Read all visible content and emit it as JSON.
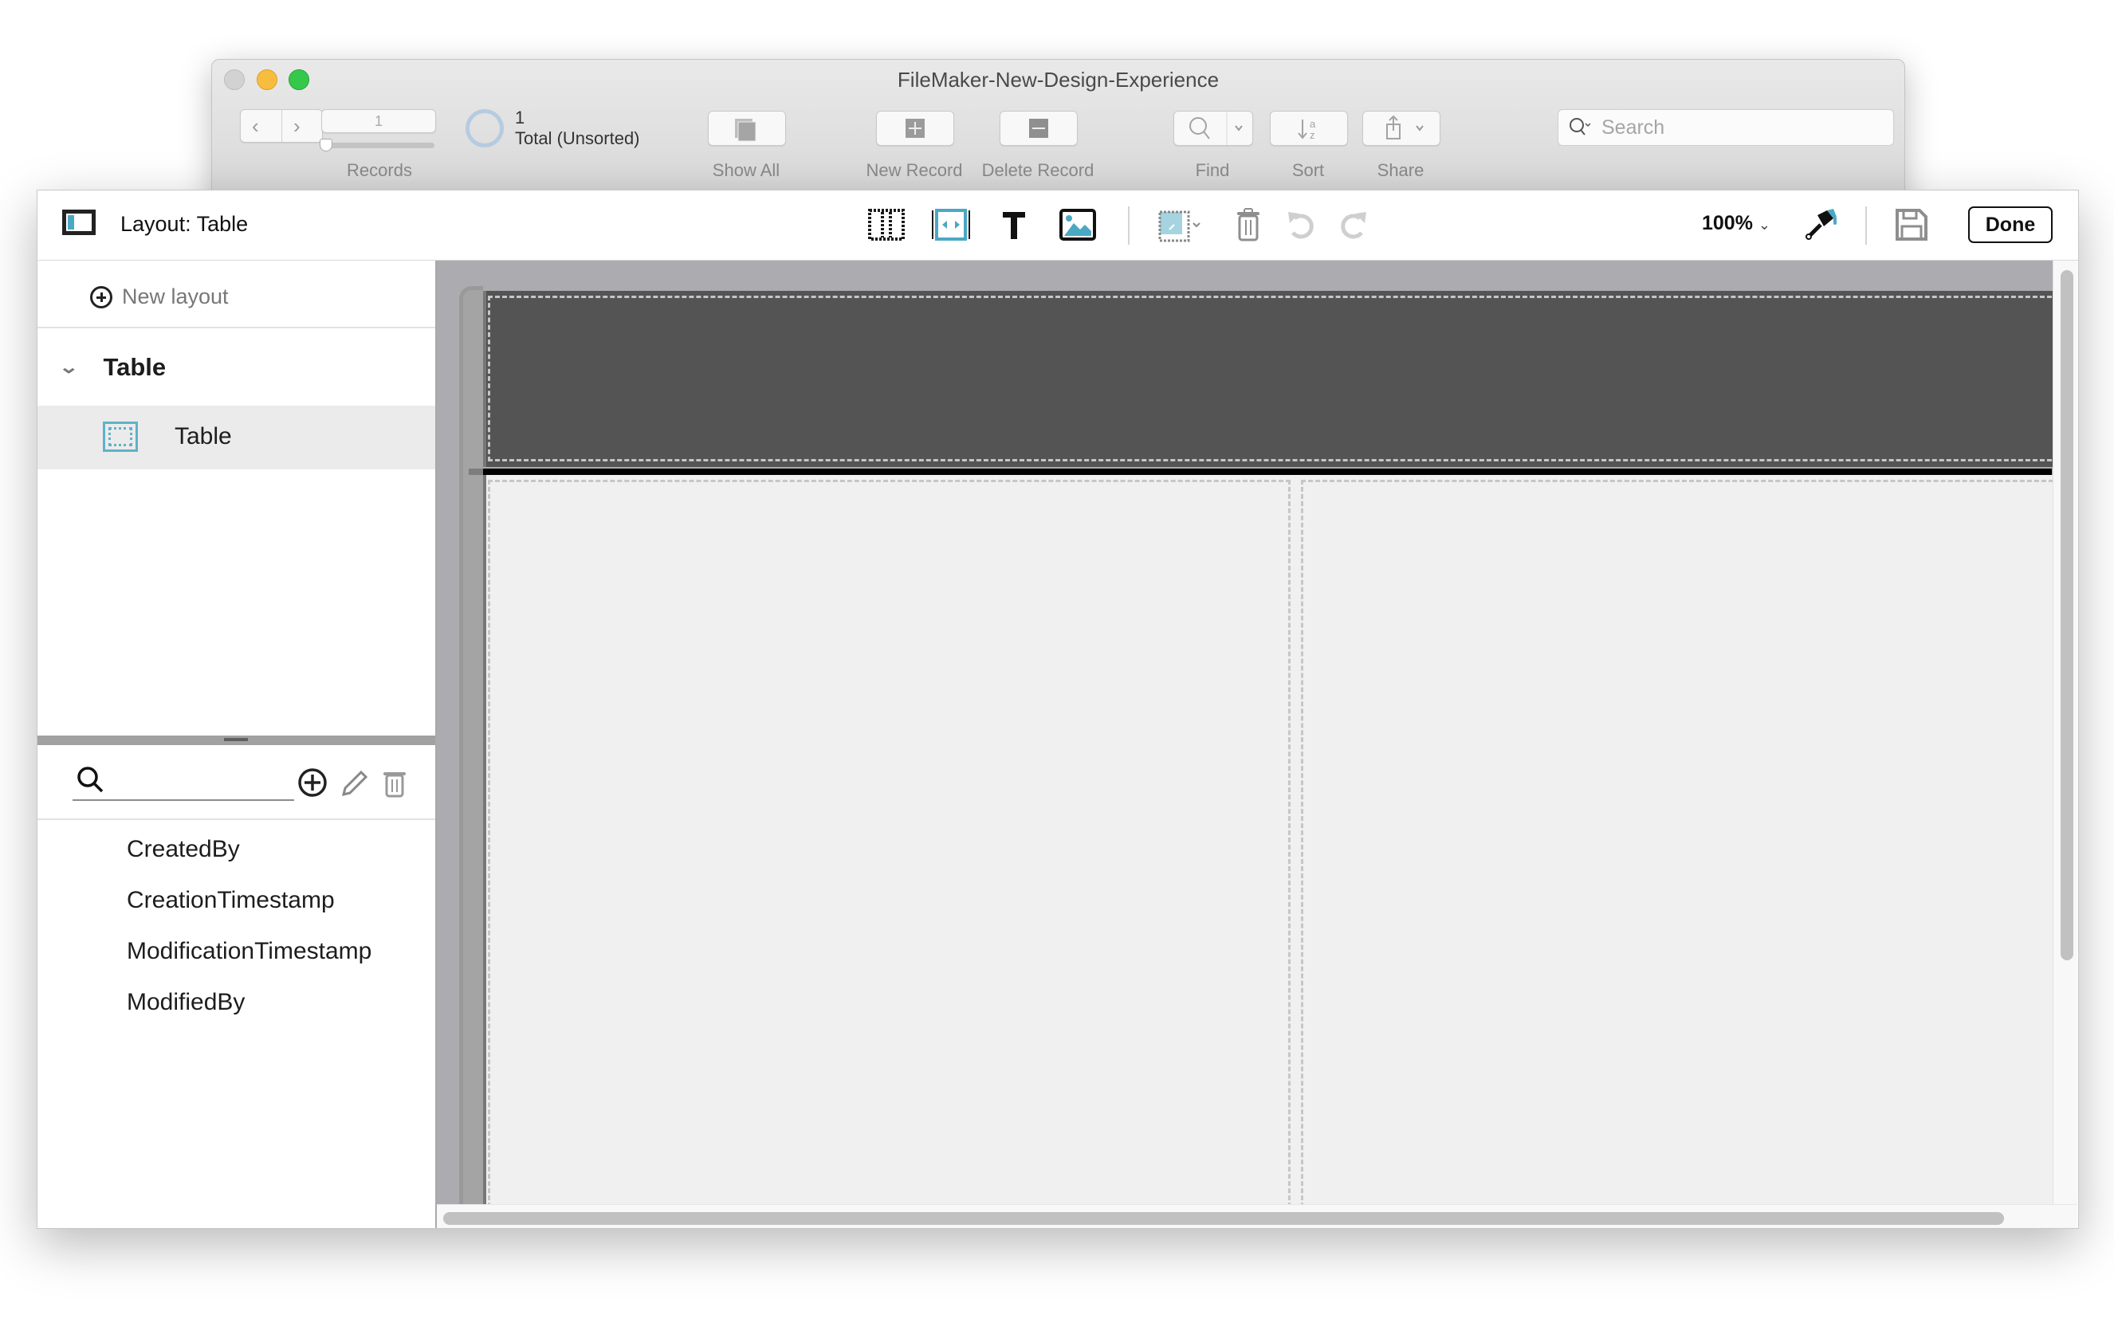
{
  "outer_window": {
    "title": "FileMaker-New-Design-Experience",
    "toolbar": {
      "records": {
        "current_record": "1",
        "found_count": "1",
        "total_status": "Total (Unsorted)",
        "position_fraction": 0.0,
        "label": "Records"
      },
      "show_all_label": "Show All",
      "new_record_label": "New Record",
      "delete_record_label": "Delete Record",
      "find_label": "Find",
      "sort_label": "Sort",
      "share_label": "Share",
      "search": {
        "placeholder": "Search",
        "value": ""
      }
    }
  },
  "layout_window": {
    "toolbar": {
      "layout_title": "Layout: Table",
      "zoom_level": "100%",
      "done_label": "Done",
      "tools": [
        "field-tool-icon",
        "button-tool-icon",
        "text-tool-icon",
        "image-tool-icon",
        "fill-style-icon",
        "delete-icon",
        "undo-icon",
        "redo-icon",
        "paint-brush-icon",
        "save-icon"
      ]
    },
    "sidebar": {
      "new_layout_label": "New layout",
      "groups": [
        {
          "name": "Table",
          "expanded": true,
          "layouts": [
            {
              "name": "Table",
              "selected": true
            }
          ]
        }
      ],
      "fields_search": {
        "placeholder": "",
        "value": ""
      },
      "fields": [
        "CreatedBy",
        "CreationTimestamp",
        "ModificationTimestamp",
        "ModifiedBy"
      ]
    },
    "canvas": {
      "parts": [
        "header",
        "body"
      ],
      "body_columns": 2
    }
  },
  "colors": {
    "accent": "#4aa8c4",
    "header_part": "#545454",
    "body_part": "#f0f0f0",
    "canvas_bg": "#acacb0",
    "traffic_close": "#d2d2d2",
    "traffic_minimize": "#f7bd3e",
    "traffic_maximize": "#35c84a"
  }
}
